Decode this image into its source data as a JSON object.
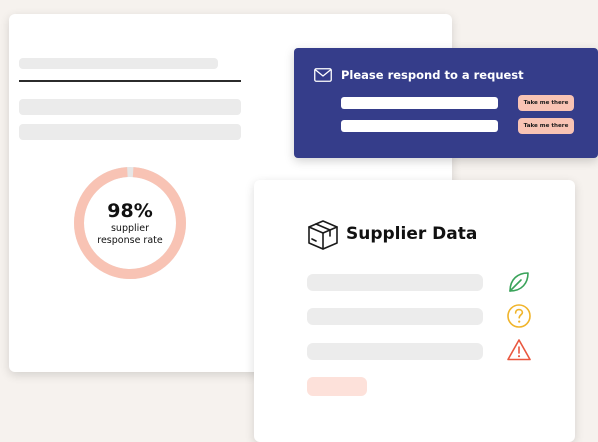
{
  "response_card": {
    "rate_value": "98%",
    "rate_label": "supplier response rate",
    "rate_fraction": 0.98,
    "colors": {
      "ring": "#f8c3b4",
      "ring_track": "#e6e6e6"
    }
  },
  "request_banner": {
    "icon": "envelope-icon",
    "title": "Please respond to a request",
    "button_label_1": "Take me there",
    "button_label_2": "Take me there",
    "colors": {
      "background": "#353d8a",
      "button": "#f8c3b4"
    }
  },
  "supplier_card": {
    "icon": "package-box-icon",
    "title": "Supplier Data",
    "status_icons": [
      "leaf-icon",
      "question-circle-icon",
      "warning-triangle-icon"
    ],
    "colors": {
      "leaf": "#3aa35a",
      "question": "#f0b42a",
      "warning": "#e9573f",
      "highlight_pill": "#fde1da"
    }
  }
}
